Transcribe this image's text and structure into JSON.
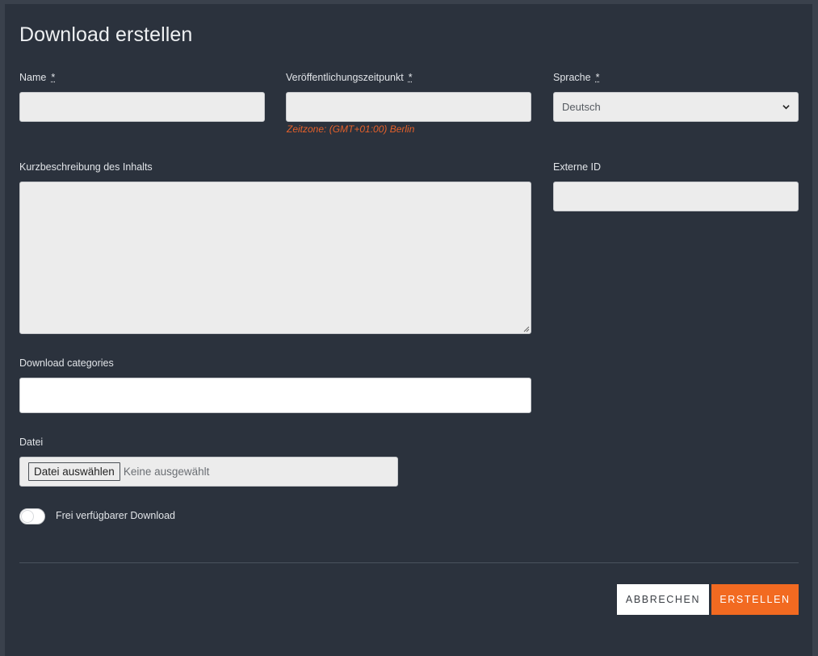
{
  "dialog": {
    "title": "Download erstellen"
  },
  "form": {
    "name": {
      "label": "Name",
      "required_mark": "*",
      "value": ""
    },
    "publish_time": {
      "label": "Veröffentlichungszeitpunkt",
      "required_mark": "*",
      "value": "",
      "timezone_hint": "Zeitzone: (GMT+01:00) Berlin"
    },
    "language": {
      "label": "Sprache",
      "required_mark": "*",
      "selected": "Deutsch"
    },
    "description": {
      "label": "Kurzbeschreibung des Inhalts",
      "value": ""
    },
    "external_id": {
      "label": "Externe ID",
      "value": ""
    },
    "categories": {
      "label": "Download categories",
      "value": ""
    },
    "file": {
      "label": "Datei",
      "button_label": "Datei auswählen",
      "status": "Keine ausgewählt"
    },
    "free_download": {
      "label": "Frei verfügbarer Download",
      "enabled": false
    }
  },
  "actions": {
    "cancel_label": "ABBRECHEN",
    "create_label": "ERSTELLEN"
  },
  "colors": {
    "background": "#2b323d",
    "accent": "#f26a21",
    "hint": "#e5602a"
  }
}
